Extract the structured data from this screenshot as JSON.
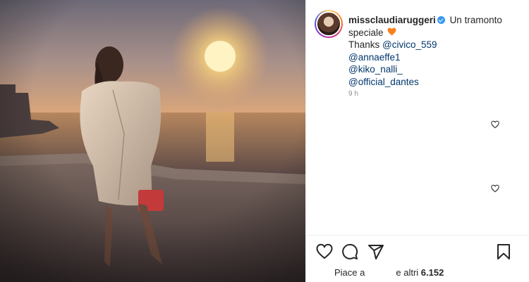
{
  "post": {
    "username": "missclaudiaruggeri",
    "caption_lines": [
      "Un tramonto",
      "speciale"
    ],
    "thanks_prefix": "Thanks ",
    "mentions": [
      "@civico_559",
      "@annaeffe1",
      "@kiko_nalli_",
      "@official_dantes"
    ],
    "time": "9 h",
    "likes_prefix": "Piace a",
    "likes_suffix": "e altri",
    "likes_count": "6.152"
  },
  "icons": {
    "verified": "verified-badge-icon",
    "heart_emoji": "orange-heart-emoji",
    "like": "heart-outline-icon",
    "comment": "comment-bubble-icon",
    "share": "paper-plane-icon",
    "save": "bookmark-icon"
  },
  "colors": {
    "text": "#262626",
    "mention": "#00376b",
    "muted": "#8e8e8e",
    "verified": "#3897f0",
    "heart_emoji": "#f5821f"
  }
}
